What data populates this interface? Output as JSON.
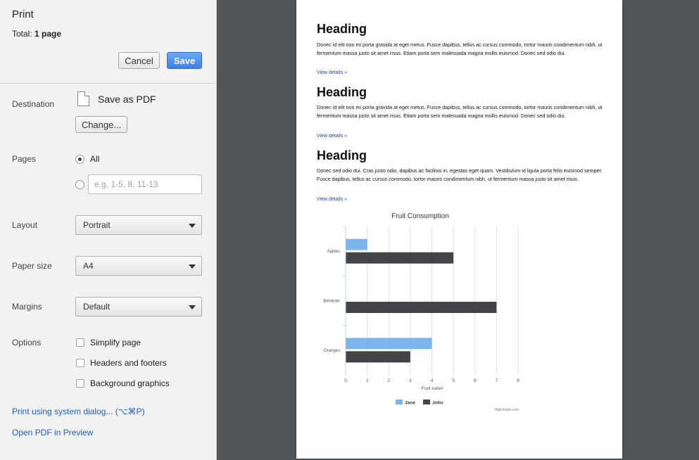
{
  "sidebar": {
    "title": "Print",
    "total_label": "Total:",
    "total_value": "1 page",
    "cancel_label": "Cancel",
    "save_label": "Save",
    "destination_label": "Destination",
    "destination_value": "Save as PDF",
    "change_label": "Change...",
    "pages_label": "Pages",
    "pages_all_label": "All",
    "pages_placeholder": "e.g. 1-5, 8, 11-13",
    "layout_label": "Layout",
    "layout_value": "Portrait",
    "paper_label": "Paper size",
    "paper_value": "A4",
    "margins_label": "Margins",
    "margins_value": "Default",
    "options_label": "Options",
    "options": [
      {
        "label": "Simplify page",
        "checked": false
      },
      {
        "label": "Headers and footers",
        "checked": false
      },
      {
        "label": "Background graphics",
        "checked": false
      }
    ],
    "system_dialog_link": "Print using system dialog... (⌥⌘P)",
    "open_pdf_link": "Open PDF in Preview"
  },
  "preview": {
    "sections": [
      {
        "heading": "Heading",
        "text": "Donec id elit non mi porta gravida at eget metus. Fusce dapibus, tellus ac cursus commodo, tortor mauris condimentum nibh, ut fermentum massa justo sit amet risus. Etiam porta sem malesuada magna mollis euismod. Donec sed odio dui.",
        "link": "View details »"
      },
      {
        "heading": "Heading",
        "text": "Donec id elit non mi porta gravida at eget metus. Fusce dapibus, tellus ac cursus commodo, tortor mauris condimentum nibh, ut fermentum massa justo sit amet risus. Etiam porta sem malesuada magna mollis euismod. Donec sed odio dui.",
        "link": "View details »"
      },
      {
        "heading": "Heading",
        "text": "Donec sed odio dui. Cras justo odio, dapibus ac facilisis in, egestas eget quam. Vestibulum id ligula porta felis euismod semper. Fusce dapibus, tellus ac cursus commodo, tortor mauris condimentum nibh, ut fermentum massa justo sit amet risus.",
        "link": "View details »"
      }
    ]
  },
  "chart_data": {
    "type": "bar",
    "orientation": "horizontal",
    "title": "Fruit Consumption",
    "categories": [
      "Apples",
      "Bananas",
      "Oranges"
    ],
    "series": [
      {
        "name": "Jane",
        "color": "#7cb5ec",
        "values": [
          1,
          0,
          4
        ]
      },
      {
        "name": "John",
        "color": "#434348",
        "values": [
          5,
          7,
          3
        ]
      }
    ],
    "xlabel": "Fruit eaten",
    "ylabel": "",
    "xlim": [
      0,
      8
    ],
    "ticks": [
      "0",
      "1",
      "2",
      "3",
      "4",
      "5",
      "6",
      "7",
      "8"
    ],
    "grid": true,
    "legend_position": "bottom-center",
    "credits": "Highcharts.com"
  },
  "colors": {
    "link": "#1a5fc8",
    "save_button": "#3c82ee",
    "background": "#525659"
  }
}
